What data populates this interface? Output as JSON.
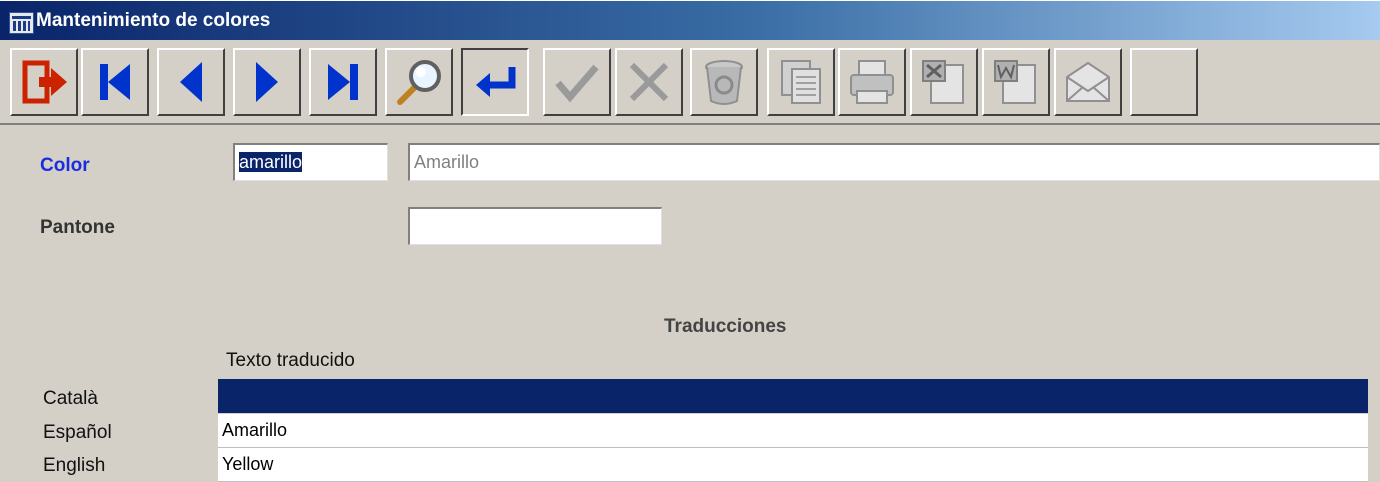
{
  "window": {
    "title": "Mantenimiento de colores",
    "app_icon": "app-icon"
  },
  "toolbar": {
    "buttons": [
      {
        "name": "exit-icon"
      },
      {
        "name": "first-record-icon"
      },
      {
        "name": "previous-record-icon"
      },
      {
        "name": "next-record-icon"
      },
      {
        "name": "last-record-icon"
      },
      {
        "name": "search-icon"
      },
      {
        "name": "enter-icon"
      },
      {
        "name": "accept-icon"
      },
      {
        "name": "cancel-icon"
      },
      {
        "name": "delete-icon"
      },
      {
        "name": "copy-icon"
      },
      {
        "name": "print-icon"
      },
      {
        "name": "excel-icon"
      },
      {
        "name": "word-icon"
      },
      {
        "name": "email-icon"
      }
    ]
  },
  "form": {
    "color_label": "Color",
    "color_code": "amarillo",
    "color_description": "Amarillo",
    "pantone_label": "Pantone",
    "pantone_value": ""
  },
  "translations": {
    "title": "Traducciones",
    "column_header": "Texto traducido",
    "rows": [
      {
        "language": "Català",
        "text": ""
      },
      {
        "language": "Español",
        "text": "Amarillo"
      },
      {
        "language": "English",
        "text": "Yellow"
      }
    ]
  },
  "colors": {
    "title_bar": "#0a246a",
    "label_accent": "#1a2ee0",
    "selection": "#0a246a",
    "nav_blue": "#0033cc",
    "exit_red": "#cc2200"
  }
}
